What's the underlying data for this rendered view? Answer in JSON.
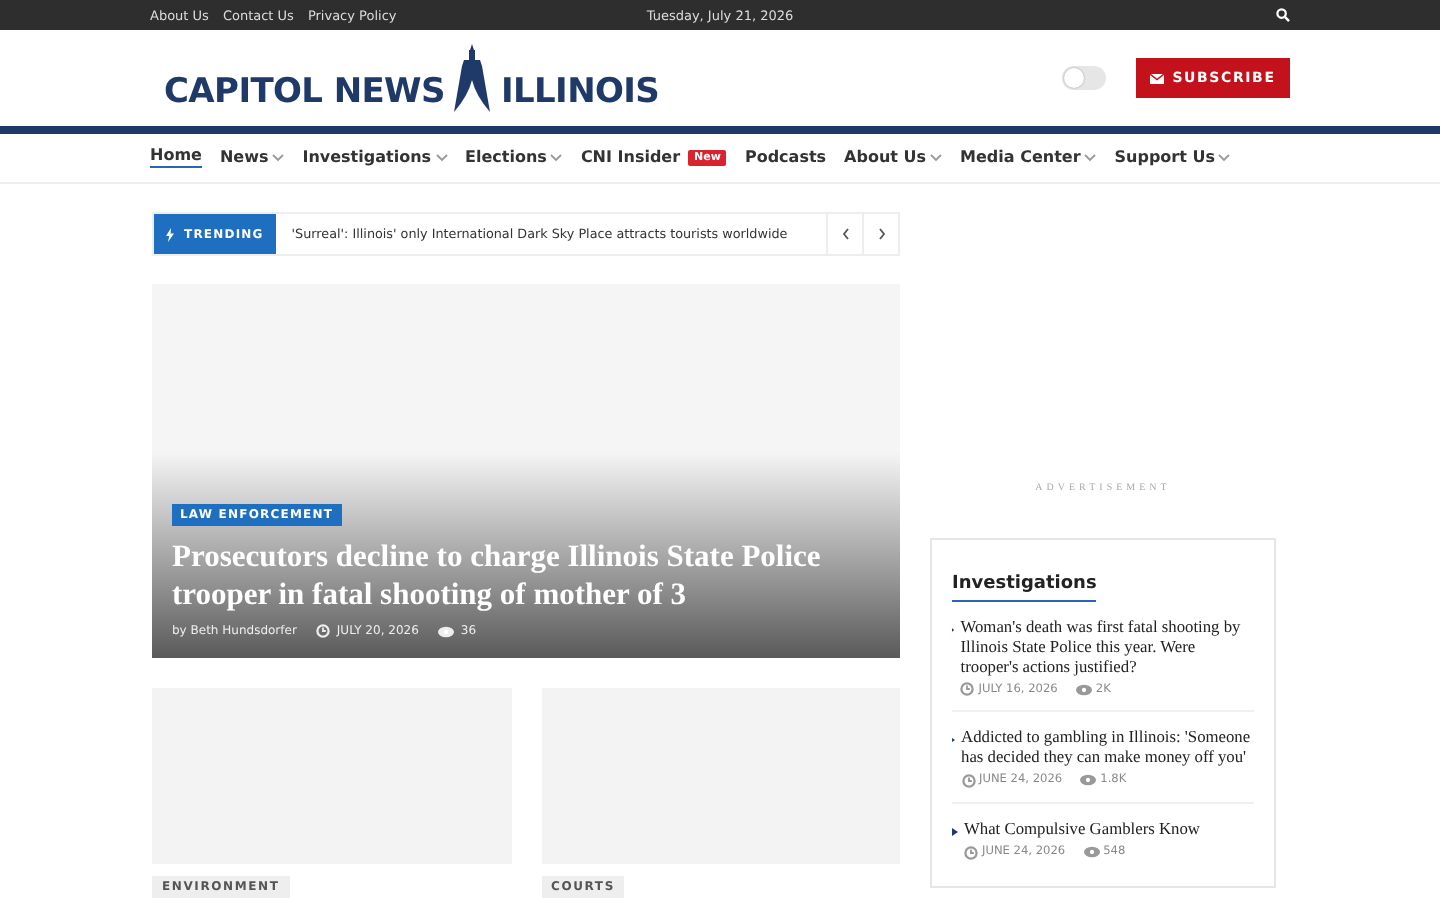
{
  "top_bar": {
    "links": [
      "About Us",
      "Contact Us",
      "Privacy Policy"
    ],
    "date": "Tuesday, July 21, 2026"
  },
  "header": {
    "logo_left": "CAPITOL NEWS",
    "logo_right": "ILLINOIS",
    "dark_mode": {
      "on": false
    },
    "subscribe": "SUBSCRIBE"
  },
  "nav": [
    {
      "label": "Home",
      "selected": true,
      "dropdown": false
    },
    {
      "label": "News",
      "selected": false,
      "dropdown": true
    },
    {
      "label": "Investigations",
      "selected": false,
      "dropdown": true
    },
    {
      "label": "Elections",
      "selected": false,
      "dropdown": true
    },
    {
      "label": "CNI Insider",
      "selected": false,
      "dropdown": false,
      "badge": "New"
    },
    {
      "label": "Podcasts",
      "selected": false,
      "dropdown": false
    },
    {
      "label": "About Us",
      "selected": false,
      "dropdown": true
    },
    {
      "label": "Media Center",
      "selected": false,
      "dropdown": true
    },
    {
      "label": "Support Us",
      "selected": false,
      "dropdown": true
    }
  ],
  "trending": {
    "label": "TRENDING",
    "headline": "'Surreal': Illinois' only International Dark Sky Place attracts tourists worldwide"
  },
  "hero": {
    "category": "LAW ENFORCEMENT",
    "title": "Prosecutors decline to charge Illinois State Police trooper in fatal shooting of mother of 3",
    "author": "by Beth Hundsdorfer",
    "date": "JULY 20, 2026",
    "views": "36"
  },
  "cards": [
    {
      "category": "ENVIRONMENT"
    },
    {
      "category": "COURTS"
    }
  ],
  "sidebar": {
    "ad_label": "ADVERTISEMENT",
    "widget_title": "Investigations",
    "items": [
      {
        "title": "Woman's death was first fatal shooting by Illinois State Police this year. Were trooper's actions justified?",
        "date": "JULY 16, 2026",
        "views": "2K"
      },
      {
        "title": "Addicted to gambling in Illinois: 'Someone has decided they can make money off you'",
        "date": "JUNE 24, 2026",
        "views": "1.8K"
      },
      {
        "title": "What Compulsive Gamblers Know",
        "date": "JUNE 24, 2026",
        "views": "548"
      }
    ]
  }
}
